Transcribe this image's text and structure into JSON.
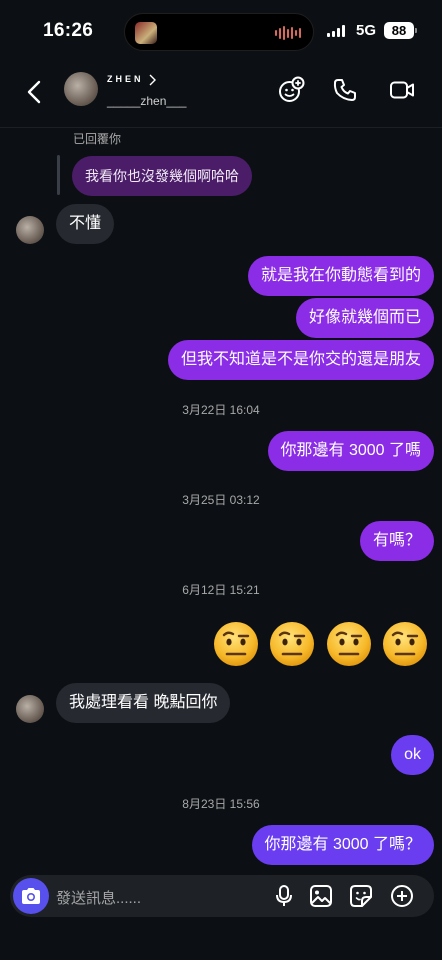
{
  "status_bar": {
    "time": "16:26",
    "network": "5G",
    "battery": "88"
  },
  "header": {
    "display_name": "ZHEN",
    "username": "_____zhen___"
  },
  "conversation": {
    "reply_context": "已回覆你",
    "quoted_text": "我看你也沒發幾個啊哈哈",
    "messages": {
      "m1": "不懂",
      "m2": "就是我在你動態看到的",
      "m3": "好像就幾個而已",
      "m4": "但我不知道是不是你交的還是朋友",
      "ts1": "3月22日 16:04",
      "m5": "你那邊有 3000 了嗎",
      "ts2": "3月25日 03:12",
      "m6": "有嗎？",
      "ts3": "6月12日 15:21",
      "m7": "我處理看看 晚點回你",
      "m8": "ok",
      "ts4": "8月23日 15:56",
      "m9": "你那邊有 3000 了嗎？"
    },
    "reaction_emoji": "face-with-raised-eyebrow"
  },
  "composer": {
    "placeholder": "發送訊息......"
  },
  "colors": {
    "background": "#0c1014",
    "sent_bubble": "#8b2ce6",
    "latest_sent_bubble": "#6a3df0",
    "received_bubble": "#262a30",
    "accent": "#5850ec"
  }
}
